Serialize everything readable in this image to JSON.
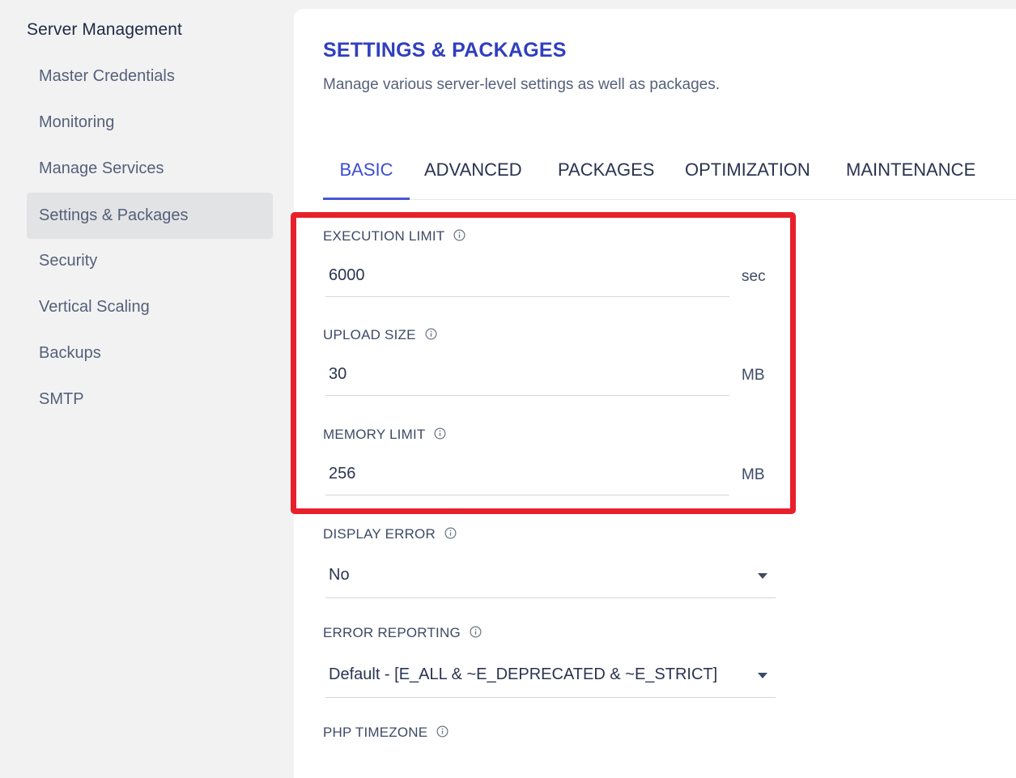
{
  "sidebar": {
    "title": "Server Management",
    "items": [
      {
        "label": "Master Credentials"
      },
      {
        "label": "Monitoring"
      },
      {
        "label": "Manage Services"
      },
      {
        "label": "Settings & Packages"
      },
      {
        "label": "Security"
      },
      {
        "label": "Vertical Scaling"
      },
      {
        "label": "Backups"
      },
      {
        "label": "SMTP"
      }
    ],
    "active_item": "Settings & Packages"
  },
  "main": {
    "title": "SETTINGS & PACKAGES",
    "subtitle": "Manage various server-level settings as well as packages.",
    "tabs": [
      {
        "label": "BASIC"
      },
      {
        "label": "ADVANCED"
      },
      {
        "label": "PACKAGES"
      },
      {
        "label": "OPTIMIZATION"
      },
      {
        "label": "MAINTENANCE"
      }
    ],
    "active_tab": "BASIC"
  },
  "fields": {
    "execution_limit": {
      "label": "EXECUTION LIMIT",
      "value": "6000",
      "unit": "sec"
    },
    "upload_size": {
      "label": "UPLOAD SIZE",
      "value": "30",
      "unit": "MB"
    },
    "memory_limit": {
      "label": "MEMORY LIMIT",
      "value": "256",
      "unit": "MB"
    },
    "display_error": {
      "label": "DISPLAY ERROR",
      "value": "No"
    },
    "error_reporting": {
      "label": "ERROR REPORTING",
      "value": "Default - [E_ALL & ~E_DEPRECATED & ~E_STRICT]"
    },
    "php_timezone": {
      "label": "PHP TIMEZONE"
    }
  },
  "icons": {
    "info": "info-circle-icon",
    "caret": "chevron-down-icon"
  },
  "colors": {
    "accent": "#3a4ed0",
    "title": "#2f3fbf",
    "highlight": "#e8202a",
    "sidebar_bg": "#f2f2f3",
    "active_item_bg": "#e2e3e4"
  }
}
